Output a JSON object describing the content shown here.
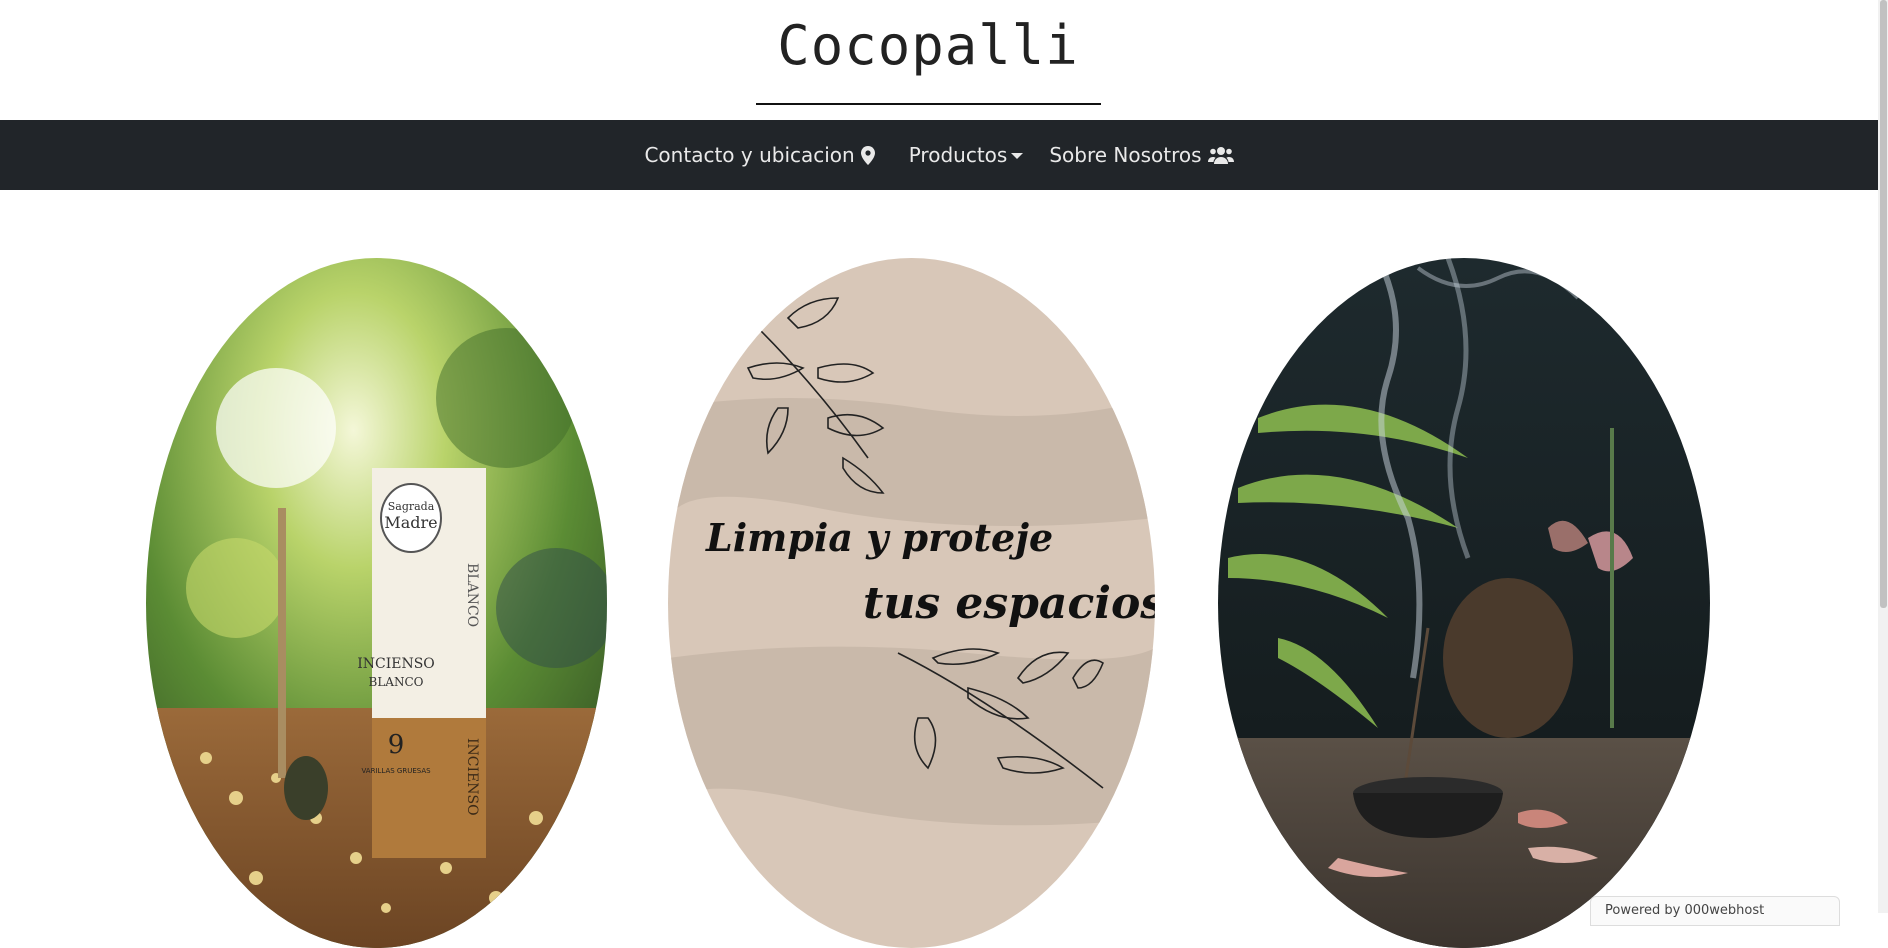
{
  "header": {
    "brand": "Cocopalli"
  },
  "nav": {
    "items": [
      {
        "label": "Contacto y ubicacion",
        "icon": "map-marker-icon"
      },
      {
        "label": "Productos",
        "icon": "caret-down-icon"
      },
      {
        "label": "Sobre Nosotros",
        "icon": "users-icon"
      }
    ]
  },
  "banner": {
    "line1": "Limpia y proteje",
    "line2": "tus espacios"
  },
  "product_box": {
    "brand_top": "Sagrada",
    "brand_name": "Madre",
    "variant": "BLANCO",
    "product": "INCIENSO",
    "product_sub": "BLANCO",
    "count": "9",
    "count_label": "VARILLAS GRUESAS",
    "side_text": "INCIENSO"
  },
  "badge": {
    "text": "Powered by 000webhost"
  },
  "colors": {
    "navbar": "#212529",
    "banner_bg": "#d8c7b8",
    "nav_text": "#e9e9e9"
  }
}
